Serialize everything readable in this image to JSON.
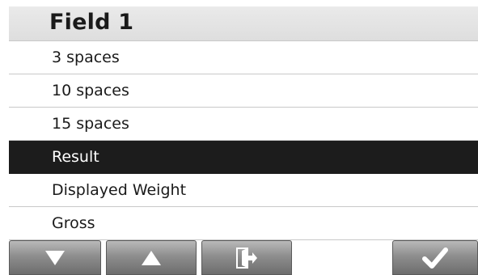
{
  "title": "Field 1",
  "items": [
    {
      "label": "3 spaces",
      "selected": false
    },
    {
      "label": "10 spaces",
      "selected": false
    },
    {
      "label": "15 spaces",
      "selected": false
    },
    {
      "label": "Result",
      "selected": true
    },
    {
      "label": "Displayed Weight",
      "selected": false
    },
    {
      "label": "Gross",
      "selected": false
    }
  ],
  "toolbar": {
    "buttons": [
      {
        "icon": "arrow-down-icon"
      },
      {
        "icon": "arrow-up-icon"
      },
      {
        "icon": "exit-door-icon"
      },
      {
        "icon": "checkmark-icon"
      }
    ]
  },
  "colors": {
    "selected_background": "#1c1c1c",
    "title_background": "#e4e4e4",
    "button_gradient_top": "#b9b9b9",
    "button_gradient_bottom": "#6d6d6d"
  }
}
